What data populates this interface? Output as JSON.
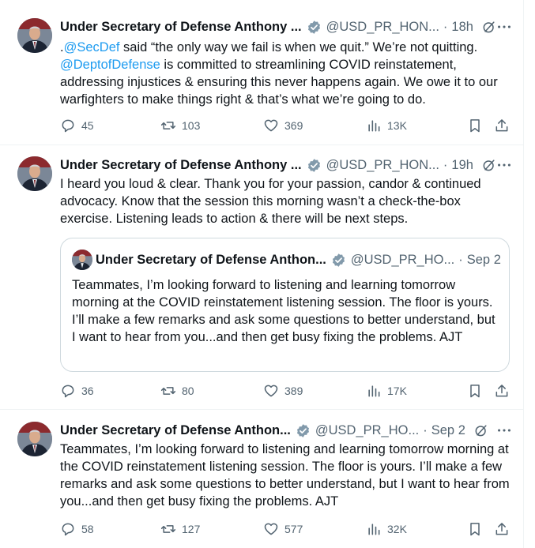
{
  "tweets": [
    {
      "name": "Under Secretary of Defense Anthony ...",
      "handle": "@USD_PR_HON...",
      "separator": "·",
      "time": "18h",
      "text_mention1": "@SecDef",
      "text_part1": " said “the only way we fail is when we quit.” We’re not quitting.",
      "text_mention2": "@DeptofDefense",
      "text_part2": " is committed to streamlining COVID reinstatement, addressing injustices & ensuring this never happens again. We owe it to our warfighters to make things right & that’s what we’re going to do.",
      "replies": "45",
      "reposts": "103",
      "likes": "369",
      "views": "13K"
    },
    {
      "name": "Under Secretary of Defense Anthony ...",
      "handle": "@USD_PR_HON...",
      "separator": "·",
      "time": "19h",
      "text": "I heard you loud & clear. Thank you for your passion, candor & continued advocacy. Know that the session this morning wasn’t a check-the-box exercise. Listening leads to action & there will be next steps.",
      "quote": {
        "name": "Under Secretary of Defense Anthon...",
        "handle": "@USD_PR_HO...",
        "separator": "·",
        "time": "Sep 2",
        "text": "Teammates, I’m looking forward to listening and learning tomorrow morning at the COVID reinstatement listening session. The floor is yours. I’ll make a few remarks and ask some questions to better understand, but I want to hear from you...and then get busy fixing the problems. AJT"
      },
      "replies": "36",
      "reposts": "80",
      "likes": "389",
      "views": "17K"
    },
    {
      "name": "Under Secretary of Defense Anthon...",
      "handle": "@USD_PR_HO...",
      "separator": "·",
      "time": "Sep 2",
      "text": "Teammates, I’m looking forward to listening and learning tomorrow morning at the COVID reinstatement listening session. The floor is yours. I’ll make a few remarks and ask some questions to better understand, but I want to hear from you...and then get busy fixing the problems. AJT",
      "replies": "58",
      "reposts": "127",
      "likes": "577",
      "views": "32K"
    }
  ],
  "icons": {
    "verified": "verified-badge-icon",
    "grok": "grok-icon",
    "more": "more-icon",
    "reply": "reply-icon",
    "repost": "repost-icon",
    "like": "like-icon",
    "views": "views-icon",
    "bookmark": "bookmark-icon",
    "share": "share-icon"
  },
  "colors": {
    "link": "#1d9bf0",
    "muted": "#536471",
    "verified": "#829aab",
    "border": "#eff3f4"
  }
}
